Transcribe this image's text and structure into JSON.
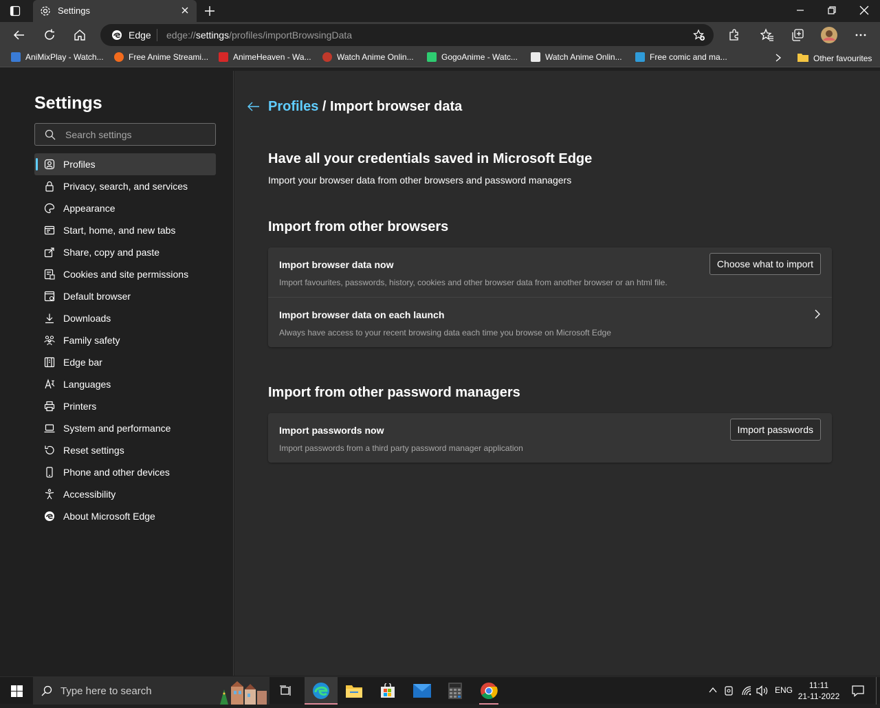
{
  "browser": {
    "tab_title": "Settings",
    "site_name": "Edge",
    "url_prefix": "edge://",
    "url_host": "settings",
    "url_path": "/profiles/importBrowsingData"
  },
  "favorites": [
    {
      "label": "AniMixPlay - Watch...",
      "color": "#3a7bd5"
    },
    {
      "label": "Free Anime Streami...",
      "color": "#f26b1d"
    },
    {
      "label": "AnimeHeaven - Wa...",
      "color": "#d62828"
    },
    {
      "label": "Watch Anime Onlin...",
      "color": "#c0392b"
    },
    {
      "label": "GogoAnime - Watc...",
      "color": "#2ecc71"
    },
    {
      "label": "Watch Anime Onlin...",
      "color": "#eaeaea"
    },
    {
      "label": "Free comic and ma...",
      "color": "#2f9bd8"
    }
  ],
  "other_favourites": "Other favourites",
  "sidebar": {
    "title": "Settings",
    "search_placeholder": "Search settings",
    "items": [
      {
        "label": "Profiles",
        "icon": "profile-icon"
      },
      {
        "label": "Privacy, search, and services",
        "icon": "lock-icon"
      },
      {
        "label": "Appearance",
        "icon": "palette-icon"
      },
      {
        "label": "Start, home, and new tabs",
        "icon": "home-tabs-icon"
      },
      {
        "label": "Share, copy and paste",
        "icon": "share-icon"
      },
      {
        "label": "Cookies and site permissions",
        "icon": "cookies-icon"
      },
      {
        "label": "Default browser",
        "icon": "browser-icon"
      },
      {
        "label": "Downloads",
        "icon": "download-icon"
      },
      {
        "label": "Family safety",
        "icon": "family-icon"
      },
      {
        "label": "Edge bar",
        "icon": "edge-bar-icon"
      },
      {
        "label": "Languages",
        "icon": "language-icon"
      },
      {
        "label": "Printers",
        "icon": "printer-icon"
      },
      {
        "label": "System and performance",
        "icon": "laptop-icon"
      },
      {
        "label": "Reset settings",
        "icon": "reset-icon"
      },
      {
        "label": "Phone and other devices",
        "icon": "phone-icon"
      },
      {
        "label": "Accessibility",
        "icon": "accessibility-icon"
      },
      {
        "label": "About Microsoft Edge",
        "icon": "edge-logo-icon"
      }
    ]
  },
  "main": {
    "breadcrumb_link": "Profiles",
    "breadcrumb_current": " / Import browser data",
    "hero_title": "Have all your credentials saved in Microsoft Edge",
    "hero_subtitle": "Import your browser data from other browsers and password managers",
    "section1_title": "Import from other browsers",
    "import_now_title": "Import browser data now",
    "import_now_desc": "Import favourites, passwords, history, cookies and other browser data from another browser or an html file.",
    "import_now_button": "Choose what to import",
    "import_launch_title": "Import browser data on each launch",
    "import_launch_desc": "Always have access to your recent browsing data each time you browse on Microsoft Edge",
    "section2_title": "Import from other password managers",
    "import_pw_title": "Import passwords now",
    "import_pw_desc": "Import passwords from a third party password manager application",
    "import_pw_button": "Import passwords"
  },
  "taskbar": {
    "search_label": "Type here to search",
    "lang": "ENG",
    "time": "11:11",
    "date": "21-11-2022"
  },
  "colors": {
    "accent": "#60cdff",
    "sidebar_bg": "#202020",
    "content_bg": "#2b2b2b",
    "card_bg": "#353535"
  }
}
